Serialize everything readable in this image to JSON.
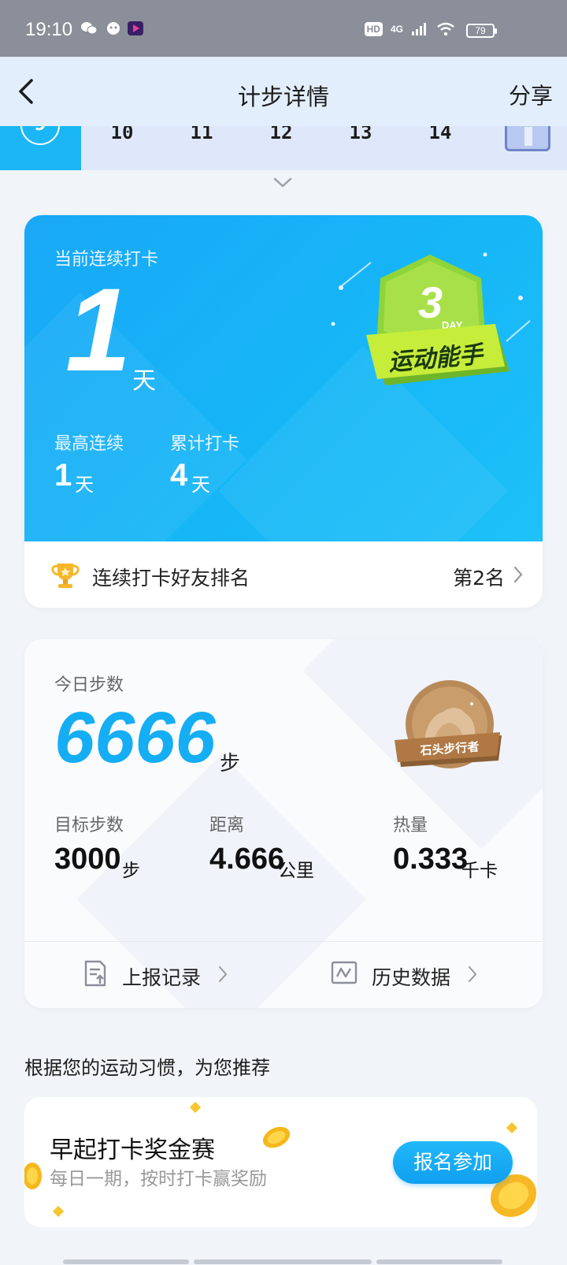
{
  "status_bar": {
    "time": "19:10",
    "hd": "HD",
    "network": "4G",
    "battery": "79",
    "icons": [
      "wechat-icon",
      "app-icon",
      "video-app-icon",
      "signal-icon",
      "wifi-icon"
    ]
  },
  "header": {
    "title": "计步详情",
    "share_label": "分享"
  },
  "date_strip": {
    "today": "9",
    "days": [
      "10",
      "11",
      "12",
      "13",
      "14"
    ]
  },
  "streak": {
    "current_label": "当前连续打卡",
    "current_value": "1",
    "current_unit": "天",
    "best_label": "最高连续",
    "best_value": "1",
    "best_unit": "天",
    "total_label": "累计打卡",
    "total_value": "4",
    "total_unit": "天",
    "badge": {
      "number": "3",
      "small": "DAY",
      "ribbon": "运动能手"
    },
    "rank_label": "连续打卡好友排名",
    "rank_value": "第2名"
  },
  "steps": {
    "today_label": "今日步数",
    "today_value": "6666",
    "today_unit": "步",
    "medal_label": "石头步行者",
    "stats": [
      {
        "label": "目标步数",
        "value": "3000",
        "unit": "步"
      },
      {
        "label": "距离",
        "value": "4.666",
        "unit": "公里"
      },
      {
        "label": "热量",
        "value": "0.333",
        "unit": "千卡"
      }
    ],
    "report_label": "上报记录",
    "history_label": "历史数据"
  },
  "recommend": {
    "heading": "根据您的运动习惯，为您推荐",
    "card_title": "早起打卡奖金赛",
    "card_subtitle": "每日一期，按时打卡赢奖励",
    "button_label": "报名参加"
  },
  "colors": {
    "accent": "#15adf3",
    "streak_bg": "#19a8f7",
    "badge_green": "#8fd43a",
    "medal_bronze": "#b88a5a"
  }
}
